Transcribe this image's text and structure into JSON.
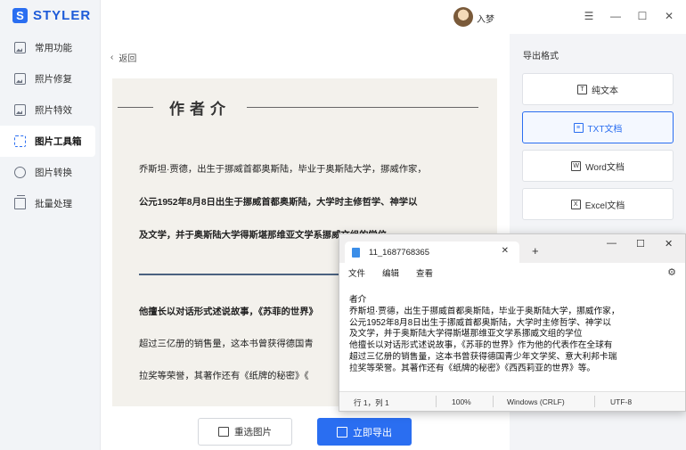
{
  "app": {
    "logo_letter": "S",
    "name": "STYLER"
  },
  "sidebar": {
    "items": [
      {
        "label": "常用功能",
        "icon": "image-icon"
      },
      {
        "label": "照片修复",
        "icon": "image-icon"
      },
      {
        "label": "照片特效",
        "icon": "sparkle-icon"
      },
      {
        "label": "图片工具箱",
        "icon": "toolbox-icon",
        "active": true
      },
      {
        "label": "图片转换",
        "icon": "convert-icon"
      },
      {
        "label": "批量处理",
        "icon": "stack-icon"
      }
    ]
  },
  "header": {
    "username": "入梦",
    "menu_glyph": "☰",
    "min_glyph": "—",
    "max_glyph": "☐",
    "close_glyph": "✕"
  },
  "main": {
    "back_label": "返回",
    "preview": {
      "heading": "作者介",
      "lines": [
        "乔斯坦·贾德，出生于挪威首都奥斯陆，毕业于奥斯陆大学，挪威作家，",
        "公元1952年8月8日出生于挪威首都奥斯陆，大学时主修哲学、神学以",
        "及文学，并于奥斯陆大学得斯堪那维亚文学系挪威文组的学位",
        "他擅长以对话形式述说故事，《苏菲的世界》",
        "超过三亿册的销售量，这本书曾获得德国青",
        "拉奖等荣誉，其著作还有《纸牌的秘密》《"
      ]
    },
    "reselect_label": "重选图片",
    "export_label": "立即导出"
  },
  "export_panel": {
    "title": "导出格式",
    "formats": [
      {
        "label": "纯文本",
        "icon": "text-file-icon",
        "selected": false
      },
      {
        "label": "TXT文档",
        "icon": "txt-file-icon",
        "selected": true
      },
      {
        "label": "Word文档",
        "icon": "word-file-icon",
        "selected": false
      },
      {
        "label": "Excel文档",
        "icon": "excel-file-icon",
        "selected": false
      }
    ]
  },
  "notepad": {
    "tab_title": "11_1687768365",
    "menus": [
      "文件",
      "编辑",
      "查看"
    ],
    "lines": [
      "者介",
      "乔斯坦·贾德，出生于挪威首都奥斯陆，毕业于奥斯陆大学，挪威作家，",
      "公元1952年8月8日出生于挪威首都奥斯陆，大学时主修哲学、神学以",
      "及文学，并于奥斯陆大学得斯堪那维亚文学系挪威文组的学位",
      "他擅长以对话形式述说故事，《苏菲的世界》作为他的代表作在全球有",
      "超过三亿册的销售量，这本书曾获得德国青少年文学奖、意大利邦卡瑞",
      "拉奖等荣誉。其著作还有《纸牌的秘密》《西西莉亚的世界》等。"
    ],
    "status": {
      "position": "行 1，列 1",
      "zoom": "100%",
      "line_ending": "Windows (CRLF)",
      "encoding": "UTF-8"
    }
  },
  "colors": {
    "accent": "#2a6ef1",
    "sidebar_bg": "#f2f4f7",
    "preview_bg": "#f3f1ec"
  }
}
